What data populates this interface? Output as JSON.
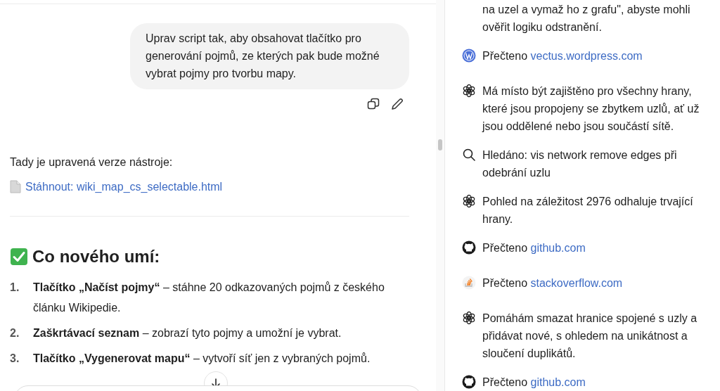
{
  "chat": {
    "user_message": "Uprav script tak, aby obsahovat tlačítko pro generování pojmů, ze kterých pak bude možné vybrat pojmy pro tvorbu mapy.",
    "intro": "Tady je upravená verze nástroje:",
    "download_link": "Stáhnout: wiki_map_cs_selectable.html",
    "heading": "Co nového umí:",
    "list": [
      {
        "number": "1.",
        "bold": "Tlačítko „Načíst pojmy“",
        "text": "– stáhne 20 odkazovaných pojmů z českého článku Wikipedie."
      },
      {
        "number": "2.",
        "bold": "Zaškrtávací seznam",
        "text": "– zobrazí tyto pojmy a umožní je vybrat."
      },
      {
        "number": "3.",
        "bold": "Tlačítko „Vygenerovat mapu“",
        "text": "– vytvoří síť jen z vybraných pojmů."
      }
    ]
  },
  "activity": [
    {
      "kind": "text",
      "text": "na uzel a vymaž ho z grafu\", abyste mohli ověřit logiku odstranění."
    },
    {
      "kind": "wordpress",
      "text": "Přečteno",
      "link": "vectus.wordpress.com"
    },
    {
      "kind": "thought",
      "text": "Má místo být zajištěno pro všechny hrany, které jsou propojeny se zbytkem uzlů, ať už jsou oddělené nebo jsou součástí sítě."
    },
    {
      "kind": "search",
      "text": "Hledáno: vis network remove edges při odebrání uzlu"
    },
    {
      "kind": "thought",
      "text": "Pohled na záležitost 2976 odhaluje trvající hrany."
    },
    {
      "kind": "github",
      "text": "Přečteno",
      "link": "github.com"
    },
    {
      "kind": "stackoverflow",
      "text": "Přečteno",
      "link": "stackoverflow.com"
    },
    {
      "kind": "thought",
      "text": "Pomáhám smazat hranice spojené s uzly a přidávat nové, s ohledem na unikátnost a sloučení duplikátů."
    },
    {
      "kind": "github",
      "text": "Přečteno",
      "link": "github.com"
    }
  ]
}
